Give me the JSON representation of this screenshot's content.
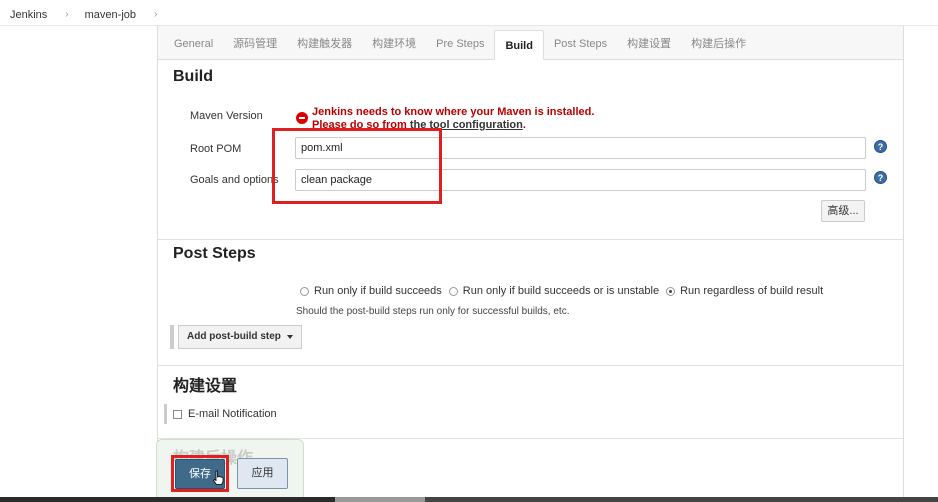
{
  "breadcrumb": [
    {
      "label": "Jenkins"
    },
    {
      "label": "maven-job"
    }
  ],
  "tabs": [
    {
      "label": "General"
    },
    {
      "label": "源码管理"
    },
    {
      "label": "构建触发器"
    },
    {
      "label": "构建环境"
    },
    {
      "label": "Pre Steps"
    },
    {
      "label": "Build"
    },
    {
      "label": "Post Steps"
    },
    {
      "label": "构建设置"
    },
    {
      "label": "构建后操作"
    }
  ],
  "active_tab": "Build",
  "build": {
    "title": "Build",
    "maven_version_label": "Maven Version",
    "error_line1": "Jenkins needs to know where your Maven is installed.",
    "error_line2_prefix": "Please do so from ",
    "error_link": "the tool configuration",
    "error_line2_suffix": ".",
    "root_pom_label": "Root POM",
    "root_pom_value": "pom.xml",
    "goals_label": "Goals and options",
    "goals_value": "clean package",
    "advanced_button": "高级..."
  },
  "post_steps": {
    "title": "Post Steps",
    "options": [
      {
        "label": "Run only if build succeeds",
        "checked": false
      },
      {
        "label": "Run only if build succeeds or is unstable",
        "checked": false
      },
      {
        "label": "Run regardless of build result",
        "checked": true
      }
    ],
    "note": "Should the post-build steps run only for successful builds, etc.",
    "add_step_button": "Add post-build step"
  },
  "build_settings": {
    "title": "构建设置",
    "email_label": "E-mail Notification",
    "email_checked": false
  },
  "footer": {
    "ghost_title": "构建后操作",
    "save_button": "保存",
    "apply_button": "应用"
  },
  "colors": {
    "highlight": "#e02020",
    "save_bg": "#3f6a8a",
    "error_text": "#b00000"
  }
}
